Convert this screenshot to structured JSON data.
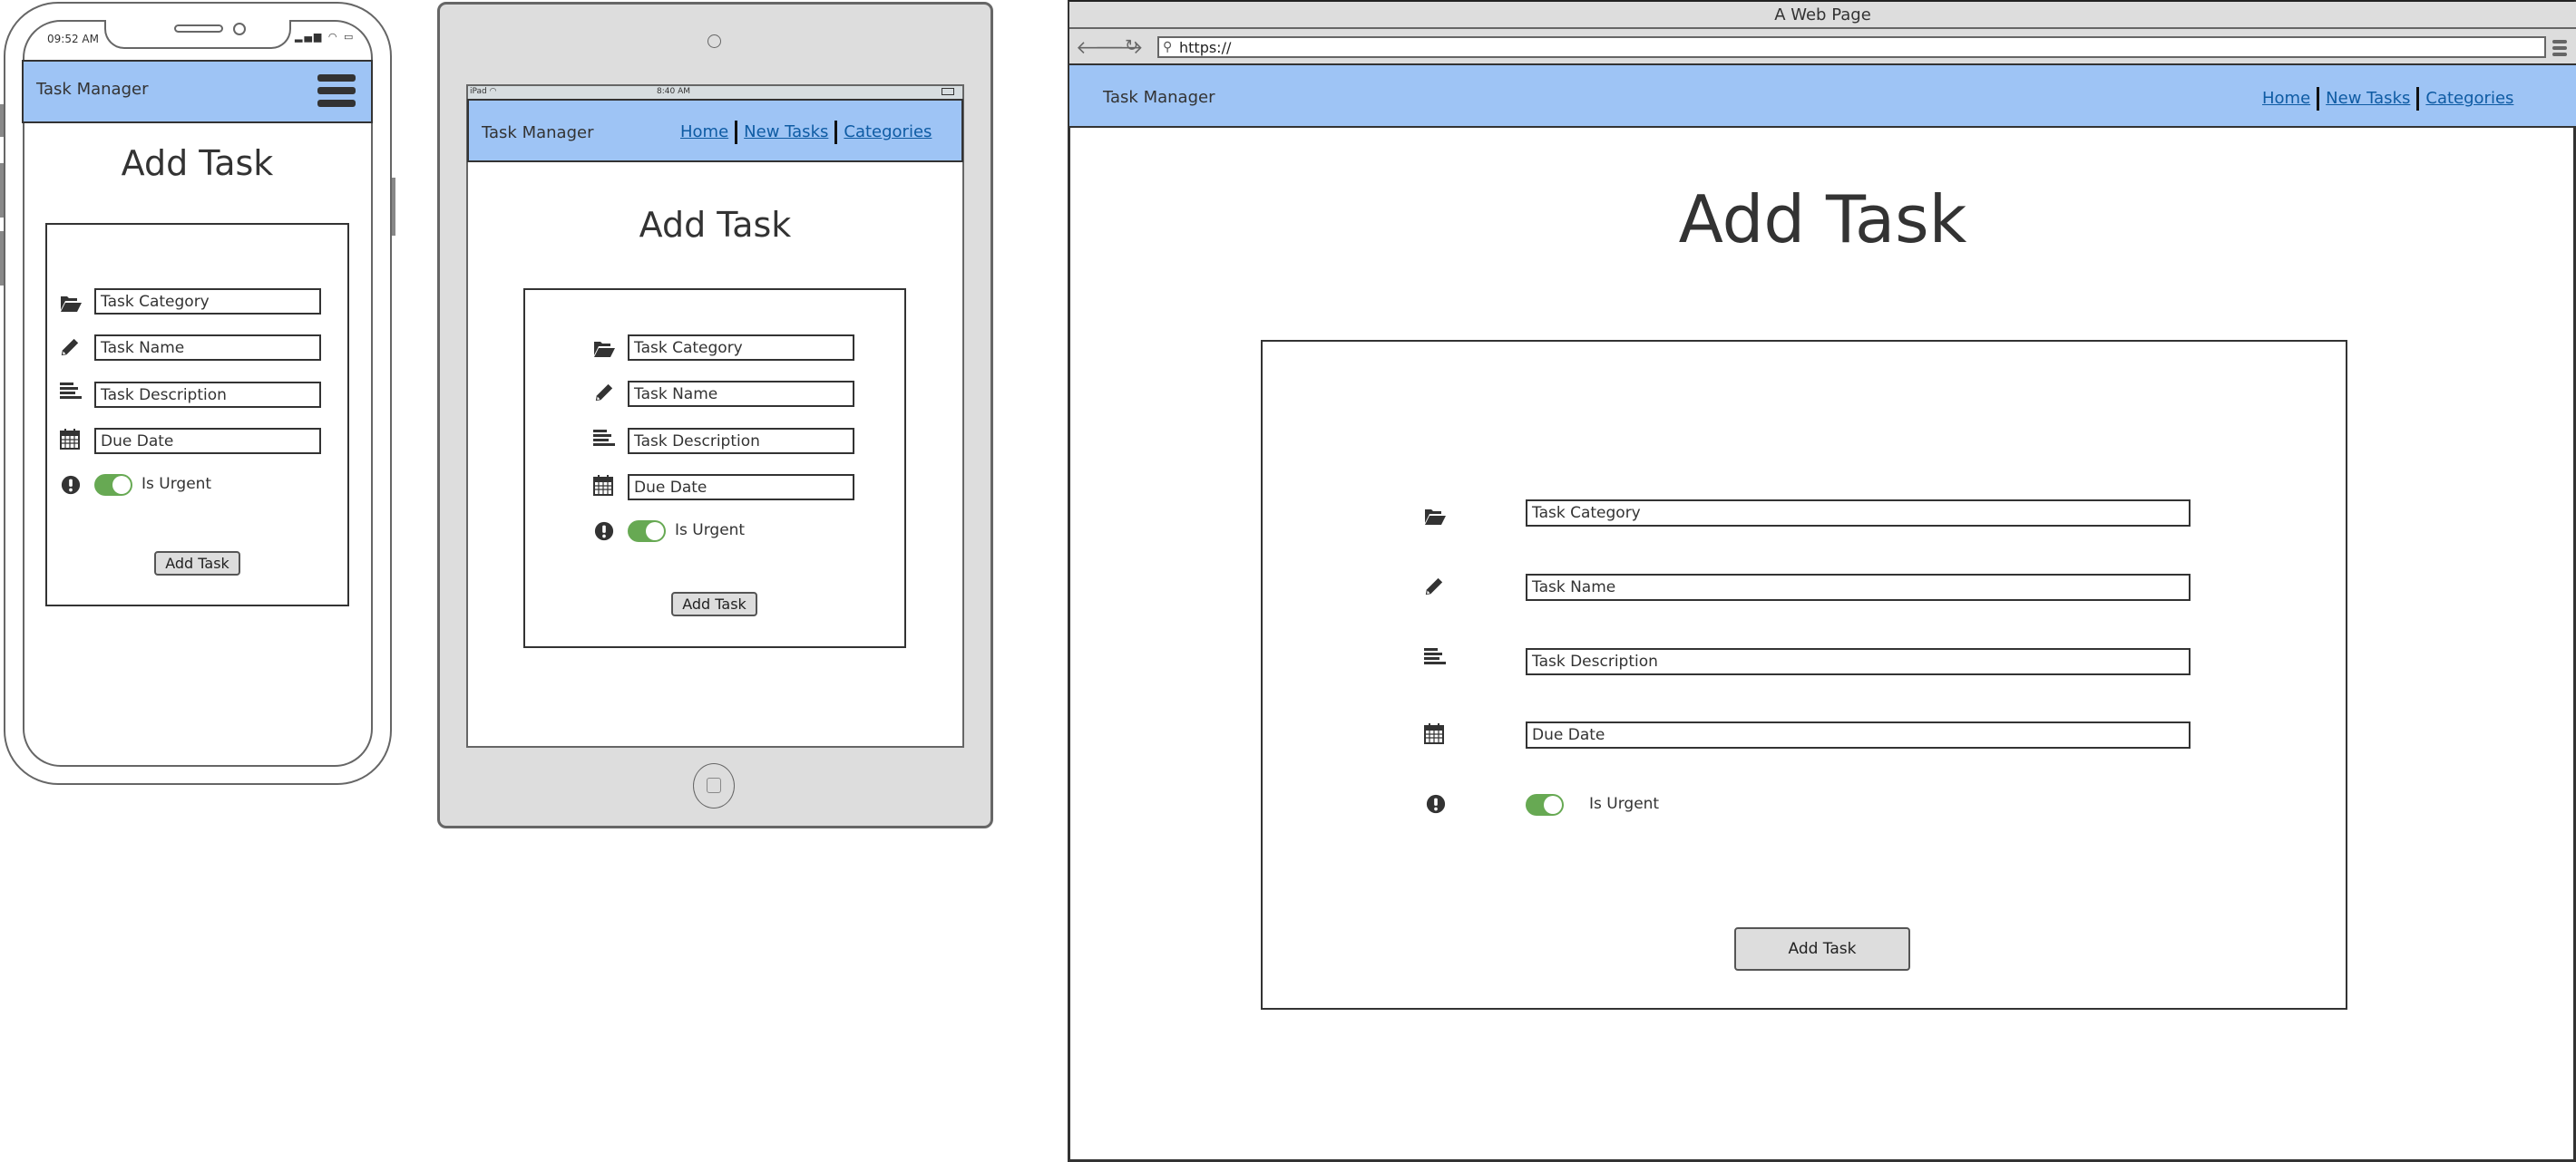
{
  "colors": {
    "header_bg": "#9ec4f5",
    "link": "#0e5ba3",
    "toggle_on": "#67a953",
    "button_bg": "#dddddd",
    "device_frame": "#dddddd",
    "text": "#333333"
  },
  "phone": {
    "status_time": "09:52 AM",
    "app_title": "Task Manager",
    "menu_icon": "hamburger-menu-icon",
    "heading": "Add Task",
    "form": {
      "fields": [
        {
          "icon": "folder-open-icon",
          "value": "Task Category"
        },
        {
          "icon": "pencil-icon",
          "value": "Task Name"
        },
        {
          "icon": "align-left-icon",
          "value": "Task Description"
        },
        {
          "icon": "calendar-icon",
          "value": "Due Date"
        }
      ],
      "urgent": {
        "icon": "exclamation-circle-icon",
        "label": "Is Urgent",
        "checked": true
      },
      "submit_label": "Add Task"
    }
  },
  "tablet": {
    "status_device": "iPad",
    "status_time": "8:40 AM",
    "app_title": "Task Manager",
    "nav": [
      "Home",
      "New Tasks",
      "Categories"
    ],
    "heading": "Add Task",
    "form": {
      "fields": [
        {
          "icon": "folder-open-icon",
          "value": "Task Category"
        },
        {
          "icon": "pencil-icon",
          "value": "Task Name"
        },
        {
          "icon": "align-left-icon",
          "value": "Task Description"
        },
        {
          "icon": "calendar-icon",
          "value": "Due Date"
        }
      ],
      "urgent": {
        "icon": "exclamation-circle-icon",
        "label": "Is Urgent",
        "checked": true
      },
      "submit_label": "Add Task"
    }
  },
  "browser": {
    "window_title": "A Web Page",
    "url": "https://",
    "app_title": "Task Manager",
    "nav": [
      "Home",
      "New Tasks",
      "Categories"
    ],
    "heading": "Add Task",
    "form": {
      "fields": [
        {
          "icon": "folder-open-icon",
          "value": "Task Category"
        },
        {
          "icon": "pencil-icon",
          "value": "Task Name"
        },
        {
          "icon": "align-left-icon",
          "value": "Task Description"
        },
        {
          "icon": "calendar-icon",
          "value": "Due Date"
        }
      ],
      "urgent": {
        "icon": "exclamation-circle-icon",
        "label": "Is Urgent",
        "checked": true
      },
      "submit_label": "Add Task"
    }
  }
}
